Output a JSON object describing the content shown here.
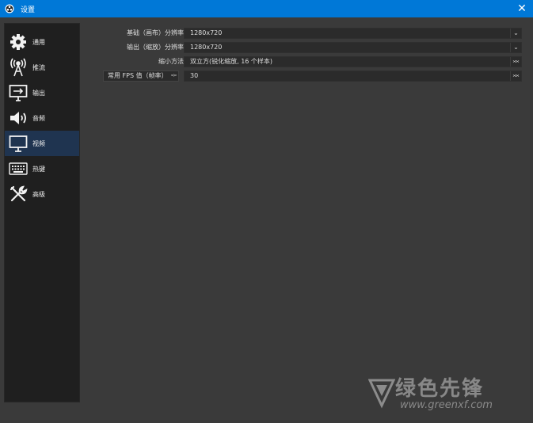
{
  "window": {
    "title": "设置",
    "close_glyph": "✕"
  },
  "sidebar": {
    "items": [
      {
        "label": "通用",
        "icon": "gear-icon"
      },
      {
        "label": "推流",
        "icon": "broadcast-antenna-icon"
      },
      {
        "label": "输出",
        "icon": "output-monitor-icon"
      },
      {
        "label": "音频",
        "icon": "speaker-icon"
      },
      {
        "label": "视频",
        "icon": "display-icon",
        "active": true
      },
      {
        "label": "热键",
        "icon": "keyboard-icon"
      },
      {
        "label": "高级",
        "icon": "tools-icon"
      }
    ]
  },
  "video": {
    "base_resolution": {
      "label": "基础（画布）分辨率",
      "value": "1280x720"
    },
    "output_resolution": {
      "label": "输出（缩放）分辨率",
      "value": "1280x720"
    },
    "downscale_filter": {
      "label": "缩小方法",
      "value": "双立方(锐化缩放, 16 个样本)"
    },
    "fps": {
      "type_label": "常用 FPS 值（帧率）",
      "value": "30"
    }
  },
  "watermark": {
    "brand": "绿色先锋",
    "url": "www.greenxf.com"
  },
  "colors": {
    "titlebar": "#0078d7",
    "active_item": "#1f3450",
    "background": "#3a3a3a",
    "sidebar": "#1f1f1f"
  }
}
